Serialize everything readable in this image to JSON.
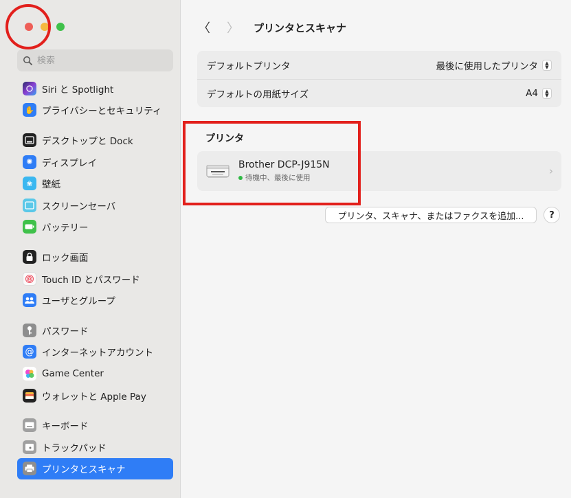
{
  "window": {
    "traffic_lights": [
      "close",
      "minimize",
      "zoom"
    ]
  },
  "search": {
    "placeholder": "検索"
  },
  "sidebar": {
    "items": [
      {
        "label": "Siri と Spotlight",
        "icon": "siri-icon",
        "color": "#6b47d8"
      },
      {
        "label": "プライバシーとセキュリティ",
        "icon": "hand-icon",
        "color": "#2f7df6"
      },
      {
        "label": "デスクトップと Dock",
        "icon": "dock-icon",
        "color": "#222222"
      },
      {
        "label": "ディスプレイ",
        "icon": "display-icon",
        "color": "#2f7df6"
      },
      {
        "label": "壁紙",
        "icon": "wallpaper-icon",
        "color": "#3ab7f0"
      },
      {
        "label": "スクリーンセーバ",
        "icon": "screensaver-icon",
        "color": "#5ac8e8"
      },
      {
        "label": "バッテリー",
        "icon": "battery-icon",
        "color": "#3fc14a"
      },
      {
        "label": "ロック画面",
        "icon": "lock-screen-icon",
        "color": "#222222"
      },
      {
        "label": "Touch ID とパスワード",
        "icon": "fingerprint-icon",
        "color": "#f3f3f3"
      },
      {
        "label": "ユーザとグループ",
        "icon": "users-icon",
        "color": "#2f7df6"
      },
      {
        "label": "パスワード",
        "icon": "key-icon",
        "color": "#8e8e8e"
      },
      {
        "label": "インターネットアカウント",
        "icon": "at-icon",
        "color": "#2f7df6"
      },
      {
        "label": "Game Center",
        "icon": "game-center-icon",
        "color": "#ffffff"
      },
      {
        "label": "ウォレットと Apple Pay",
        "icon": "wallet-icon",
        "color": "#222222"
      },
      {
        "label": "キーボード",
        "icon": "keyboard-icon",
        "color": "#a0a0a0"
      },
      {
        "label": "トラックパッド",
        "icon": "trackpad-icon",
        "color": "#a0a0a0"
      },
      {
        "label": "プリンタとスキャナ",
        "icon": "printer-icon",
        "color": "#8e8e8e",
        "selected": true
      }
    ]
  },
  "toolbar": {
    "back_glyph": "〈",
    "forward_glyph": "〉",
    "title": "プリンタとスキャナ"
  },
  "settings": {
    "default_printer_label": "デフォルトプリンタ",
    "default_printer_value": "最後に使用したプリンタ",
    "paper_size_label": "デフォルトの用紙サイズ",
    "paper_size_value": "A4"
  },
  "printers": {
    "section_title": "プリンタ",
    "items": [
      {
        "name": "Brother DCP-J915N",
        "status": "待機中、最後に使用",
        "status_color": "#2fb944"
      }
    ]
  },
  "actions": {
    "add_label": "プリンタ、スキャナ、またはファクスを追加...",
    "help_label": "?"
  },
  "annotations": {
    "highlight_color": "#e2201c"
  }
}
